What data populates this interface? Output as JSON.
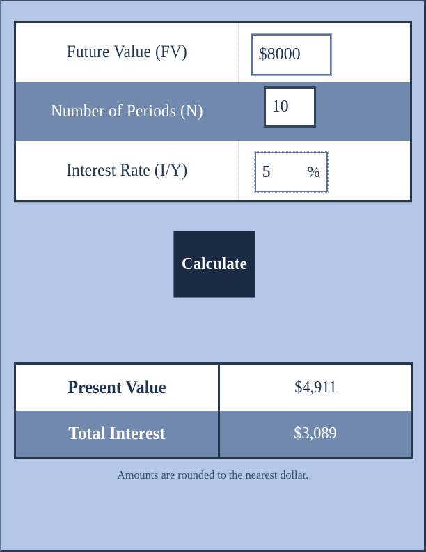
{
  "calculator": {
    "inputs": [
      {
        "label": "Future Value (FV)",
        "value": "$8000",
        "suffix": "",
        "row_style": "white"
      },
      {
        "label": "Number of Periods (N)",
        "value": "10",
        "suffix": "",
        "row_style": "slate"
      },
      {
        "label": "Interest Rate (I/Y)",
        "value": "5",
        "suffix": "%",
        "row_style": "white"
      }
    ],
    "calculate_button": "Calculate",
    "results": [
      {
        "label": "Present Value",
        "value": "$4,911"
      },
      {
        "label": "Total Interest",
        "value": "$3,089"
      }
    ],
    "footnote": "Amounts are rounded to the nearest dollar."
  },
  "colors": {
    "background": "#b4c7e7",
    "slate_row": "#7089ad",
    "border_dark": "#27374e",
    "button": "#1b2b44",
    "text_dark": "#1f3555"
  }
}
